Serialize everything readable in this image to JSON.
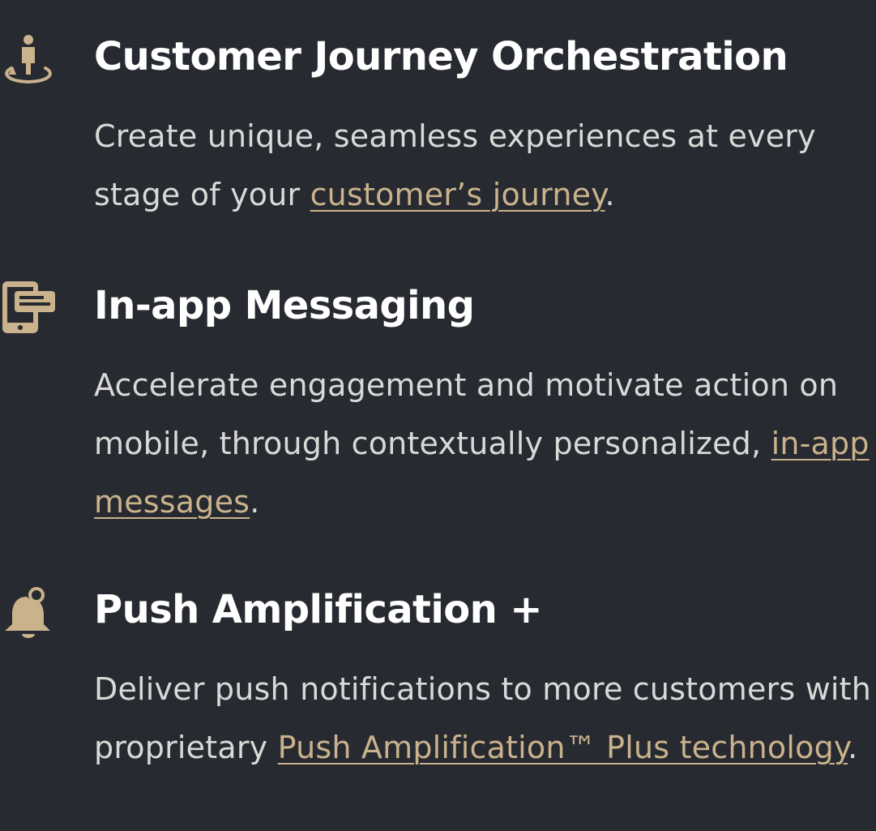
{
  "colors": {
    "background": "#272a30",
    "heading": "#ffffff",
    "body_text": "#d9d9d9",
    "accent": "#c9b28c"
  },
  "features": [
    {
      "icon": "person-orbit-icon",
      "title": "Customer Journey Orchestration",
      "text_before": "Create unique, seamless experiences at every stage of your ",
      "link": "customer’s journey",
      "text_after": "."
    },
    {
      "icon": "mobile-message-icon",
      "title": "In-app Messaging",
      "text_before": "Accelerate engagement and motivate action on mobile, through contextually personalized, ",
      "link": "in-app messages",
      "text_after": "."
    },
    {
      "icon": "bell-icon",
      "title": "Push Amplification +",
      "text_before": "Deliver push notifications to more customers with proprietary ",
      "link": "Push Amplification™ Plus technology",
      "text_after": "."
    }
  ]
}
